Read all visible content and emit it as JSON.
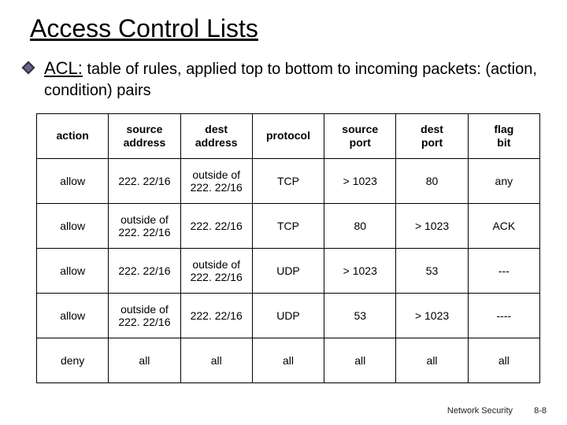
{
  "title": "Access Control Lists",
  "bullet": {
    "acl_label": "ACL:",
    "text_rest": " table of rules, applied top to bottom to incoming packets: (action, condition) pairs"
  },
  "table": {
    "headers": [
      "action",
      "source\naddress",
      "dest\naddress",
      "protocol",
      "source\nport",
      "dest\nport",
      "flag\nbit"
    ],
    "rows": [
      [
        "allow",
        "222. 22/16",
        "outside of\n222. 22/16",
        "TCP",
        "> 1023",
        "80",
        "any"
      ],
      [
        "allow",
        "outside of\n222. 22/16",
        "222. 22/16",
        "TCP",
        "80",
        "> 1023",
        "ACK"
      ],
      [
        "allow",
        "222. 22/16",
        "outside of\n222. 22/16",
        "UDP",
        "> 1023",
        "53",
        "---"
      ],
      [
        "allow",
        "outside of\n222. 22/16",
        "222. 22/16",
        "UDP",
        "53",
        "> 1023",
        "----"
      ],
      [
        "deny",
        "all",
        "all",
        "all",
        "all",
        "all",
        "all"
      ]
    ]
  },
  "footer": {
    "label": "Network Security",
    "page": "8-8"
  }
}
